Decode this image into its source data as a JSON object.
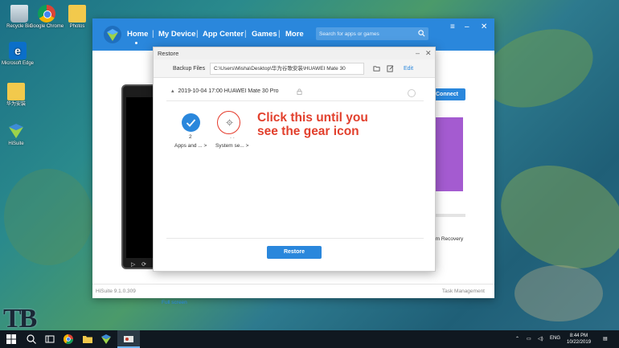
{
  "desktop": {
    "icons": [
      {
        "label": "Recycle Bin"
      },
      {
        "label": "Google Chrome"
      },
      {
        "label": "Photos"
      },
      {
        "label": "Microsoft Edge"
      },
      {
        "label": "华为安装"
      },
      {
        "label": "HiSuite"
      }
    ]
  },
  "hisuite": {
    "nav": [
      "Home",
      "My Device",
      "App Center",
      "Games",
      "More"
    ],
    "search_placeholder": "Search for apps or games",
    "connect_label": "Connect",
    "system_recovery": "em Recovery",
    "full_screen": "Full screen",
    "version": "HiSuite 9.1.0.309",
    "task_management": "Task Management"
  },
  "restore_dialog": {
    "title": "Restore",
    "backup_files_label": "Backup Files",
    "backup_path": "C:\\Users\\Misha\\Desktop\\华为谷歌安装\\HUAWEI Mate 30",
    "edit_label": "Edit",
    "entry": "2019-10-04 17:00 HUAWEI Mate 30 Pro",
    "items": [
      {
        "count": "2",
        "label": "Apps and ... >"
      },
      {
        "count": "",
        "label": "System se... >"
      }
    ],
    "system_indicator": "- -",
    "restore_button": "Restore"
  },
  "annotation": {
    "line1": "Click this until you",
    "line2": "see the gear icon"
  },
  "taskbar": {
    "language": "ENG",
    "time": "8:44 PM",
    "date": "10/22/2019"
  },
  "colors": {
    "accent": "#2a87dc",
    "annotation": "#e2402d"
  }
}
